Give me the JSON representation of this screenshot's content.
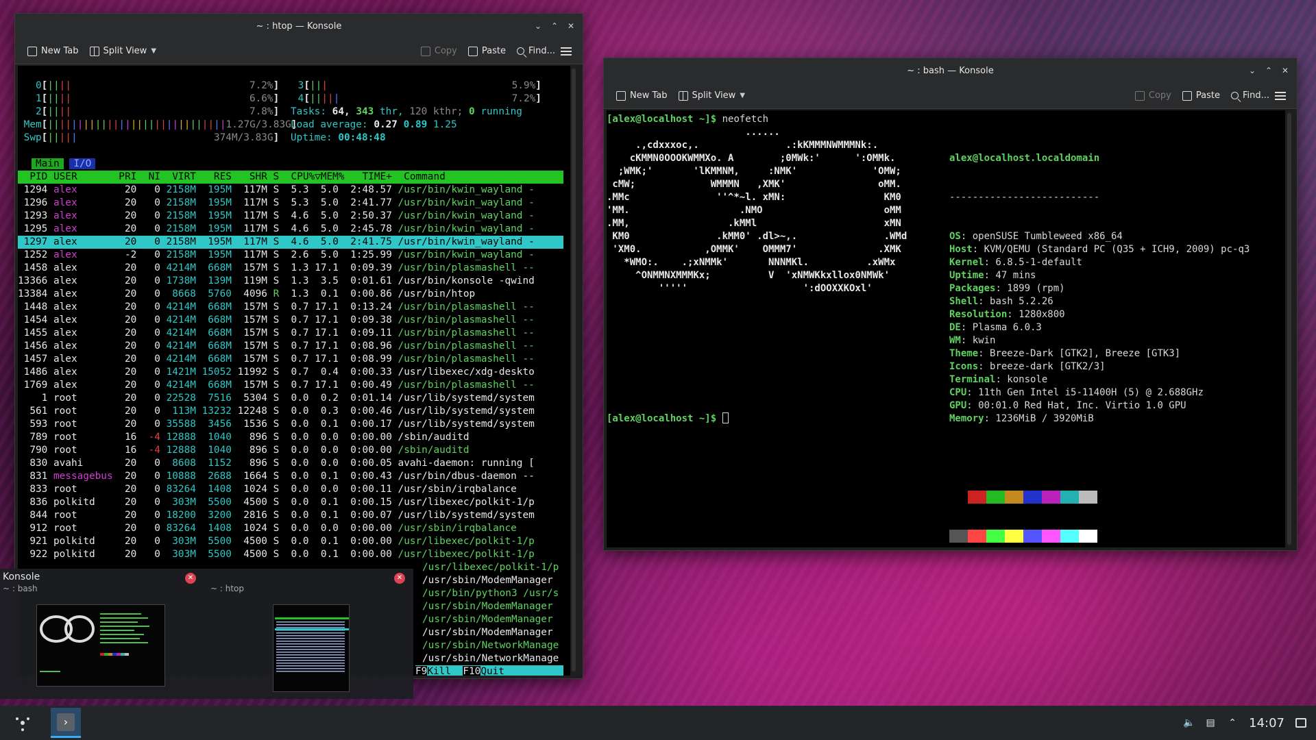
{
  "htop_window": {
    "title": "~ : htop — Konsole",
    "toolbar": {
      "new_tab": "New Tab",
      "split_view": "Split View",
      "copy": "Copy",
      "paste": "Paste",
      "find": "Find..."
    },
    "meters_left": [
      {
        "label": "0",
        "bar": "||||",
        "value": "7.2%"
      },
      {
        "label": "1",
        "bar": "||||",
        "value": "6.6%"
      },
      {
        "label": "2",
        "bar": "||||",
        "value": "7.8%"
      },
      {
        "label": "Mem",
        "bar": "||||||||||||||||||||||||||||||",
        "value": "1.27G/3.83G"
      },
      {
        "label": "Swp",
        "bar": "|||||",
        "value": "374M/3.83G"
      }
    ],
    "meters_right": [
      {
        "label": "3",
        "bar": "|||",
        "value": "5.9%"
      },
      {
        "label": "4",
        "bar": "|||||",
        "value": "7.2%"
      }
    ],
    "tasks_label": "Tasks:",
    "tasks": "64,",
    "thr": "343",
    "thr_label": "thr,",
    "kthr": "120 kthr;",
    "running": "0",
    "running_label": "running",
    "load_label": "Load average:",
    "load1": "0.27",
    "load5": "0.89",
    "load15": "1.25",
    "uptime_label": "Uptime:",
    "uptime": "00:48:48",
    "tabs": [
      "Main",
      "I/O"
    ],
    "columns": "  PID USER       PRI  NI  VIRT   RES   SHR S  CPU%▽MEM%   TIME+  Command",
    "processes": [
      [
        "1294",
        "alex",
        "20",
        "0",
        "2158M",
        "195M",
        "117M",
        "S",
        "5.3",
        "5.0",
        "2:48.57",
        "/usr/bin/kwin_wayland -"
      ],
      [
        "1296",
        "alex",
        "20",
        "0",
        "2158M",
        "195M",
        "117M",
        "S",
        "5.3",
        "5.0",
        "2:41.77",
        "/usr/bin/kwin_wayland -"
      ],
      [
        "1293",
        "alex",
        "20",
        "0",
        "2158M",
        "195M",
        "117M",
        "S",
        "4.6",
        "5.0",
        "2:50.37",
        "/usr/bin/kwin_wayland -"
      ],
      [
        "1295",
        "alex",
        "20",
        "0",
        "2158M",
        "195M",
        "117M",
        "S",
        "4.6",
        "5.0",
        "2:45.78",
        "/usr/bin/kwin_wayland -"
      ],
      [
        "1297",
        "alex",
        "20",
        "0",
        "2158M",
        "195M",
        "117M",
        "S",
        "4.6",
        "5.0",
        "2:41.75",
        "/usr/bin/kwin_wayland -"
      ],
      [
        "1252",
        "alex",
        "-2",
        "0",
        "2158M",
        "195M",
        "117M",
        "S",
        "2.6",
        "5.0",
        "1:25.99",
        "/usr/bin/kwin_wayland -"
      ],
      [
        "1458",
        "alex",
        "20",
        "0",
        "4214M",
        "668M",
        "157M",
        "S",
        "1.3",
        "17.1",
        "0:09.39",
        "/usr/bin/plasmashell --"
      ],
      [
        "13366",
        "alex",
        "20",
        "0",
        "1738M",
        "139M",
        "119M",
        "S",
        "1.3",
        "3.5",
        "0:01.61",
        "/usr/bin/konsole -qwind"
      ],
      [
        "13384",
        "alex",
        "20",
        "0",
        "8668",
        "5760",
        "4096",
        "R",
        "1.3",
        "0.1",
        "0:00.86",
        "/usr/bin/htop"
      ],
      [
        "1448",
        "alex",
        "20",
        "0",
        "4214M",
        "668M",
        "157M",
        "S",
        "0.7",
        "17.1",
        "0:13.24",
        "/usr/bin/plasmashell --"
      ],
      [
        "1454",
        "alex",
        "20",
        "0",
        "4214M",
        "668M",
        "157M",
        "S",
        "0.7",
        "17.1",
        "0:09.38",
        "/usr/bin/plasmashell --"
      ],
      [
        "1455",
        "alex",
        "20",
        "0",
        "4214M",
        "668M",
        "157M",
        "S",
        "0.7",
        "17.1",
        "0:09.11",
        "/usr/bin/plasmashell --"
      ],
      [
        "1456",
        "alex",
        "20",
        "0",
        "4214M",
        "668M",
        "157M",
        "S",
        "0.7",
        "17.1",
        "0:08.96",
        "/usr/bin/plasmashell --"
      ],
      [
        "1457",
        "alex",
        "20",
        "0",
        "4214M",
        "668M",
        "157M",
        "S",
        "0.7",
        "17.1",
        "0:08.99",
        "/usr/bin/plasmashell --"
      ],
      [
        "1486",
        "alex",
        "20",
        "0",
        "1421M",
        "15052",
        "11992",
        "S",
        "0.7",
        "0.4",
        "0:00.33",
        "/usr/libexec/xdg-deskto"
      ],
      [
        "1769",
        "alex",
        "20",
        "0",
        "4214M",
        "668M",
        "157M",
        "S",
        "0.7",
        "17.1",
        "0:00.49",
        "/usr/bin/plasmashell --"
      ],
      [
        "1",
        "root",
        "20",
        "0",
        "22528",
        "7516",
        "5304",
        "S",
        "0.0",
        "0.2",
        "0:01.14",
        "/usr/lib/systemd/system"
      ],
      [
        "561",
        "root",
        "20",
        "0",
        "113M",
        "13232",
        "12248",
        "S",
        "0.0",
        "0.3",
        "0:00.46",
        "/usr/lib/systemd/system"
      ],
      [
        "593",
        "root",
        "20",
        "0",
        "35588",
        "3456",
        "1536",
        "S",
        "0.0",
        "0.1",
        "0:00.17",
        "/usr/lib/systemd/system"
      ],
      [
        "789",
        "root",
        "16",
        "-4",
        "12888",
        "1040",
        "896",
        "S",
        "0.0",
        "0.0",
        "0:00.00",
        "/sbin/auditd"
      ],
      [
        "790",
        "root",
        "16",
        "-4",
        "12888",
        "1040",
        "896",
        "S",
        "0.0",
        "0.0",
        "0:00.00",
        "/sbin/auditd"
      ],
      [
        "830",
        "avahi",
        "20",
        "0",
        "8608",
        "1152",
        "896",
        "S",
        "0.0",
        "0.0",
        "0:00.05",
        "avahi-daemon: running ["
      ],
      [
        "831",
        "messagebus",
        "20",
        "0",
        "10888",
        "2688",
        "1664",
        "S",
        "0.0",
        "0.1",
        "0:00.43",
        "/usr/bin/dbus-daemon --"
      ],
      [
        "833",
        "root",
        "20",
        "0",
        "83264",
        "1408",
        "1024",
        "S",
        "0.0",
        "0.0",
        "0:00.11",
        "/usr/sbin/irqbalance"
      ],
      [
        "836",
        "polkitd",
        "20",
        "0",
        "303M",
        "5500",
        "4500",
        "S",
        "0.0",
        "0.1",
        "0:00.15",
        "/usr/libexec/polkit-1/p"
      ],
      [
        "844",
        "root",
        "20",
        "0",
        "18200",
        "3200",
        "2816",
        "S",
        "0.0",
        "0.1",
        "0:00.07",
        "/usr/lib/systemd/system"
      ],
      [
        "912",
        "root",
        "20",
        "0",
        "83264",
        "1408",
        "1024",
        "S",
        "0.0",
        "0.0",
        "0:00.00",
        "/usr/sbin/irqbalance"
      ],
      [
        "921",
        "polkitd",
        "20",
        "0",
        "303M",
        "5500",
        "4500",
        "S",
        "0.0",
        "0.1",
        "0:00.00",
        "/usr/libexec/polkit-1/p"
      ],
      [
        "922",
        "polkitd",
        "20",
        "0",
        "303M",
        "5500",
        "4500",
        "S",
        "0.0",
        "0.1",
        "0:00.00",
        "/usr/libexec/polkit-1/p"
      ]
    ],
    "overflow_commands": [
      "/usr/libexec/polkit-1/p",
      "/usr/sbin/ModemManager",
      "/usr/bin/python3 /usr/s",
      "/usr/sbin/ModemManager",
      "/usr/sbin/ModemManager",
      "/usr/sbin/ModemManager",
      "/usr/sbin/NetworkManage",
      "/usr/sbin/NetworkManage"
    ],
    "fkeys": [
      {
        "key": "F9",
        "label": "Kill  "
      },
      {
        "key": "F10",
        "label": "Quit"
      }
    ]
  },
  "bash_window": {
    "title": "~ : bash — Konsole",
    "toolbar": {
      "new_tab": "New Tab",
      "split_view": "Split View",
      "copy": "Copy",
      "paste": "Paste",
      "find": "Find..."
    },
    "prompt": "[alex@localhost ~]$",
    "command": "neofetch",
    "logo": [
      "                        ......",
      "     .,cdxxxoc,.               .:kKMMMNWMMMNk:.",
      "    cKMMN0OOOKWMMXo. A        ;0MWk:'      ':OMMk.",
      "  ;WMK;'       'lKMMNM,     :NMK'             'OMW;",
      " cMW;             WMMMN   ,XMK'                oMM.",
      ".MMc               ''^*~l. xMN:                 KM0",
      "'MM.                   .NMO                     oMM",
      ".MM,                 .kMMl                      xMN",
      " KM0               .kMM0' .dl>~,.               .WMd",
      " 'XM0.           ,OMMK'    OMMM7'              .XMK",
      "   *WMO:.    .;xNMMk'       NNNMKl.          .xWMx",
      "     ^ONMMNXMMMKx;          V  'xNMWKkxllox0NMWk'",
      "         '''''                    ':dOOXXKOxl'"
    ],
    "user_host": "alex@localhost.localdomain",
    "separator": "--------------------------",
    "info": [
      {
        "key": "OS",
        "value": "openSUSE Tumbleweed x86_64"
      },
      {
        "key": "Host",
        "value": "KVM/QEMU (Standard PC (Q35 + ICH9, 2009) pc-q3"
      },
      {
        "key": "Kernel",
        "value": "6.8.5-1-default"
      },
      {
        "key": "Uptime",
        "value": "47 mins"
      },
      {
        "key": "Packages",
        "value": "1899 (rpm)"
      },
      {
        "key": "Shell",
        "value": "bash 5.2.26"
      },
      {
        "key": "Resolution",
        "value": "1280x800"
      },
      {
        "key": "DE",
        "value": "Plasma 6.0.3"
      },
      {
        "key": "WM",
        "value": "kwin"
      },
      {
        "key": "Theme",
        "value": "Breeze-Dark [GTK2], Breeze [GTK3]"
      },
      {
        "key": "Icons",
        "value": "breeze-dark [GTK2/3]"
      },
      {
        "key": "Terminal",
        "value": "konsole"
      },
      {
        "key": "CPU",
        "value": "11th Gen Intel i5-11400H (5) @ 2.688GHz"
      },
      {
        "key": "GPU",
        "value": "00:01.0 Red Hat, Inc. Virtio 1.0 GPU"
      },
      {
        "key": "Memory",
        "value": "1236MiB / 3920MiB"
      }
    ],
    "palette_top": [
      "#000000",
      "#cc2222",
      "#22bb22",
      "#c48a20",
      "#2233cc",
      "#bb22bb",
      "#22b0b0",
      "#bbbbbb"
    ],
    "palette_bottom": [
      "#555555",
      "#ff4444",
      "#44ff44",
      "#ffff44",
      "#5555ff",
      "#ff55ff",
      "#55ffff",
      "#ffffff"
    ],
    "prompt2": "[alex@localhost ~]$"
  },
  "switcher": {
    "items": [
      {
        "title": "Konsole",
        "subtitle": "~ : bash"
      },
      {
        "title": "",
        "subtitle": "~ : htop"
      }
    ]
  },
  "taskbar": {
    "clock": "14:07"
  },
  "colors": {
    "accent": "#3daee9",
    "htop_green": "#22c322",
    "htop_cyan": "#2fc7c7"
  }
}
